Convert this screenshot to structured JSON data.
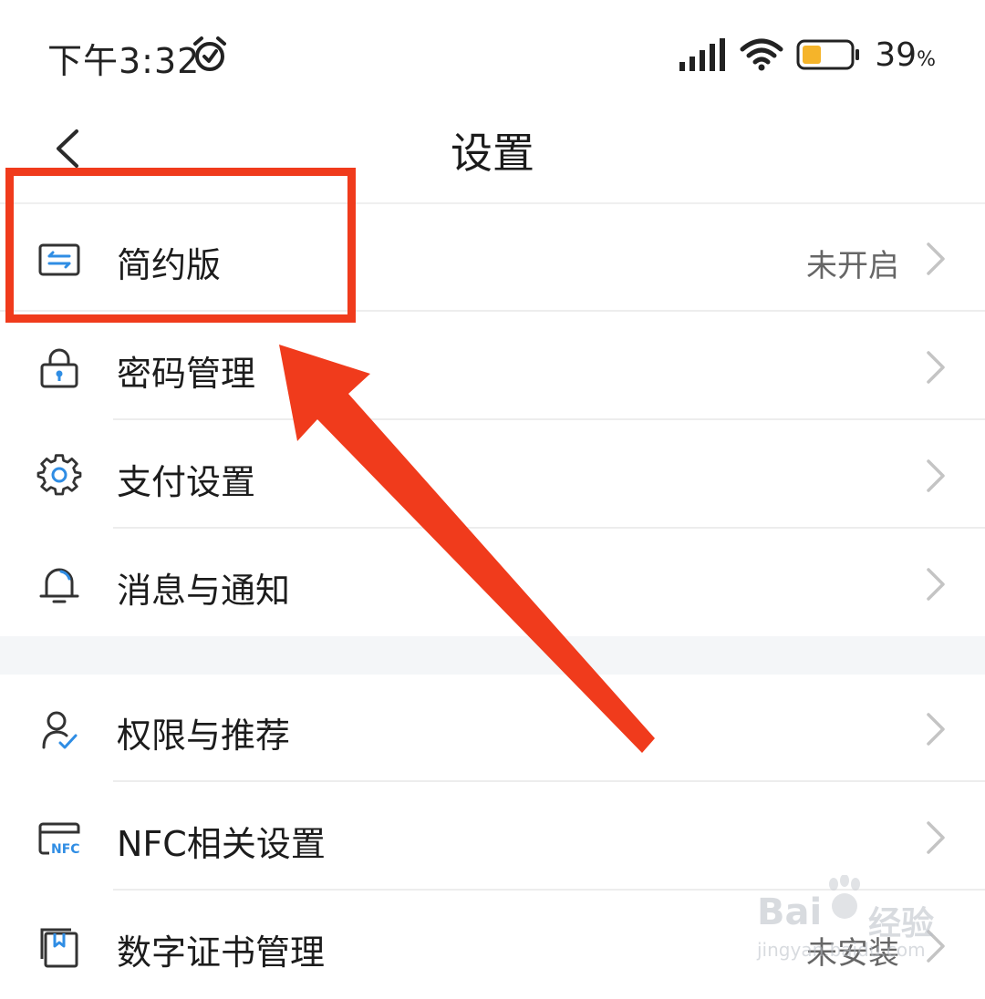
{
  "status_bar": {
    "time": "下午3:32",
    "battery_percent": "39",
    "battery_unit": "%",
    "battery_level": 0.39
  },
  "header": {
    "title": "设置"
  },
  "settings": {
    "group1": [
      {
        "label": "简约版",
        "value": "未开启",
        "icon": "simple-mode-icon"
      },
      {
        "label": "密码管理",
        "value": "",
        "icon": "lock-icon"
      },
      {
        "label": "支付设置",
        "value": "",
        "icon": "gear-icon"
      },
      {
        "label": "消息与通知",
        "value": "",
        "icon": "bell-icon"
      }
    ],
    "group2": [
      {
        "label": "权限与推荐",
        "value": "",
        "icon": "user-check-icon"
      },
      {
        "label": "NFC相关设置",
        "value": "",
        "icon": "nfc-card-icon"
      },
      {
        "label": "数字证书管理",
        "value": "未安装",
        "icon": "certificate-icon"
      }
    ]
  },
  "watermark": {
    "logo": "Bai",
    "text": "经验",
    "url": "jingyan.baidu.com"
  },
  "colors": {
    "accent_blue": "#2f8de4",
    "annotation_red": "#f03b1c",
    "battery_yellow": "#f5b42a"
  }
}
